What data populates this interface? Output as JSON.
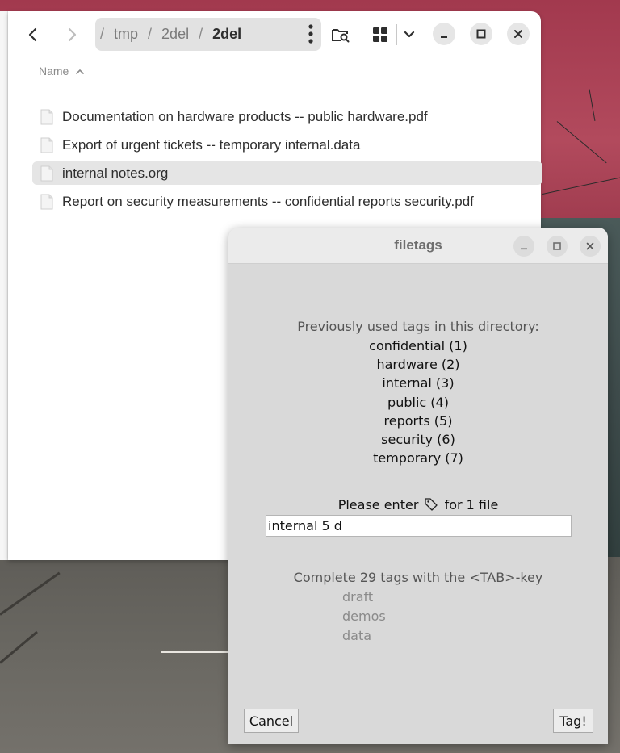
{
  "file_manager": {
    "nav": {
      "back_icon": "chevron-left-icon",
      "forward_icon": "chevron-right-icon"
    },
    "breadcrumb": {
      "segments": [
        "tmp",
        "2del",
        "2del"
      ],
      "separator": "/"
    },
    "column_header": {
      "name_label": "Name"
    },
    "files": [
      {
        "name": "Documentation on hardware products -- public hardware.pdf",
        "selected": false
      },
      {
        "name": "Export of urgent tickets -- temporary internal.data",
        "selected": false
      },
      {
        "name": "internal notes.org",
        "selected": true
      },
      {
        "name": "Report on security measurements -- confidential reports security.pdf",
        "selected": false
      }
    ]
  },
  "dialog": {
    "title": "filetags",
    "previous_label": "Previously used tags in this directory:",
    "tags": [
      "confidential (1)",
      "hardware (2)",
      "internal (3)",
      "public (4)",
      "reports (5)",
      "security (6)",
      "temporary (7)"
    ],
    "prompt_before": "Please enter",
    "prompt_icon": "tag-icon",
    "prompt_after": "for 1 file",
    "input_value": "internal 5 d",
    "complete_label": "Complete 29 tags with the <TAB>-key",
    "suggestions": [
      "draft",
      "demos",
      "data"
    ],
    "cancel_label": "Cancel",
    "ok_label": "Tag!"
  }
}
